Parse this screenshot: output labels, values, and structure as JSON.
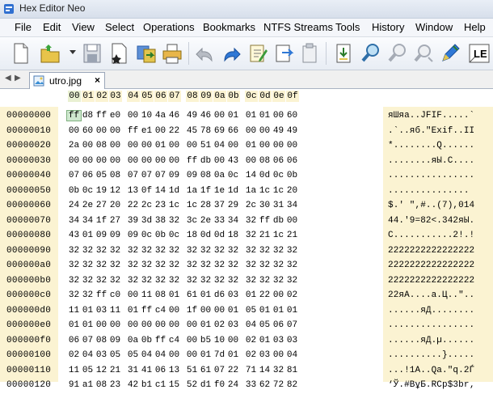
{
  "window": {
    "title": "Hex Editor Neo"
  },
  "menu": [
    "File",
    "Edit",
    "View",
    "Select",
    "Operations",
    "Bookmarks",
    "NTFS Streams",
    "Tools",
    "History",
    "Window",
    "Help"
  ],
  "toolbar": {
    "buttons": [
      "new-file-icon",
      "open-file-icon",
      "save-icon",
      "save-as-icon",
      "save-all-icon",
      "print-icon",
      "undo-icon",
      "redo-icon",
      "edit-icon",
      "paste-icon",
      "copy-icon",
      "import-icon",
      "find-icon",
      "find-next-icon",
      "replace-icon",
      "pen-icon",
      "endian-icon"
    ],
    "endian_label": "LE"
  },
  "tabs": {
    "nav_left": "◀",
    "nav_right": "▶",
    "active": {
      "label": "utro.jpg",
      "close": "×"
    }
  },
  "columns": [
    "00",
    "01",
    "02",
    "03",
    "04",
    "05",
    "06",
    "07",
    "08",
    "09",
    "0a",
    "0b",
    "0c",
    "0d",
    "0e",
    "0f"
  ],
  "rows": [
    {
      "offset": "00000000",
      "bytes": [
        "ff",
        "d8",
        "ff",
        "e0",
        "00",
        "10",
        "4a",
        "46",
        "49",
        "46",
        "00",
        "01",
        "01",
        "01",
        "00",
        "60"
      ],
      "ascii": "яШяа..JFIF.....`"
    },
    {
      "offset": "00000010",
      "bytes": [
        "00",
        "60",
        "00",
        "00",
        "ff",
        "e1",
        "00",
        "22",
        "45",
        "78",
        "69",
        "66",
        "00",
        "00",
        "49",
        "49"
      ],
      "ascii": ".`..яб.\"Exif..II"
    },
    {
      "offset": "00000020",
      "bytes": [
        "2a",
        "00",
        "08",
        "00",
        "00",
        "00",
        "01",
        "00",
        "00",
        "51",
        "04",
        "00",
        "01",
        "00",
        "00",
        "00"
      ],
      "ascii": "*........Q......"
    },
    {
      "offset": "00000030",
      "bytes": [
        "00",
        "00",
        "00",
        "00",
        "00",
        "00",
        "00",
        "00",
        "ff",
        "db",
        "00",
        "43",
        "00",
        "08",
        "06",
        "06"
      ],
      "ascii": "........яЫ.C...."
    },
    {
      "offset": "00000040",
      "bytes": [
        "07",
        "06",
        "05",
        "08",
        "07",
        "07",
        "07",
        "09",
        "09",
        "08",
        "0a",
        "0c",
        "14",
        "0d",
        "0c",
        "0b"
      ],
      "ascii": "................"
    },
    {
      "offset": "00000050",
      "bytes": [
        "0b",
        "0c",
        "19",
        "12",
        "13",
        "0f",
        "14",
        "1d",
        "1a",
        "1f",
        "1e",
        "1d",
        "1a",
        "1c",
        "1c",
        "20"
      ],
      "ascii": "............... "
    },
    {
      "offset": "00000060",
      "bytes": [
        "24",
        "2e",
        "27",
        "20",
        "22",
        "2c",
        "23",
        "1c",
        "1c",
        "28",
        "37",
        "29",
        "2c",
        "30",
        "31",
        "34"
      ],
      "ascii": "$.' \",#..(7),014"
    },
    {
      "offset": "00000070",
      "bytes": [
        "34",
        "34",
        "1f",
        "27",
        "39",
        "3d",
        "38",
        "32",
        "3c",
        "2e",
        "33",
        "34",
        "32",
        "ff",
        "db",
        "00"
      ],
      "ascii": "44.'9=82<.342яЫ."
    },
    {
      "offset": "00000080",
      "bytes": [
        "43",
        "01",
        "09",
        "09",
        "09",
        "0c",
        "0b",
        "0c",
        "18",
        "0d",
        "0d",
        "18",
        "32",
        "21",
        "1c",
        "21"
      ],
      "ascii": "C...........2!.!"
    },
    {
      "offset": "00000090",
      "bytes": [
        "32",
        "32",
        "32",
        "32",
        "32",
        "32",
        "32",
        "32",
        "32",
        "32",
        "32",
        "32",
        "32",
        "32",
        "32",
        "32"
      ],
      "ascii": "2222222222222222"
    },
    {
      "offset": "000000a0",
      "bytes": [
        "32",
        "32",
        "32",
        "32",
        "32",
        "32",
        "32",
        "32",
        "32",
        "32",
        "32",
        "32",
        "32",
        "32",
        "32",
        "32"
      ],
      "ascii": "2222222222222222"
    },
    {
      "offset": "000000b0",
      "bytes": [
        "32",
        "32",
        "32",
        "32",
        "32",
        "32",
        "32",
        "32",
        "32",
        "32",
        "32",
        "32",
        "32",
        "32",
        "32",
        "32"
      ],
      "ascii": "2222222222222222"
    },
    {
      "offset": "000000c0",
      "bytes": [
        "32",
        "32",
        "ff",
        "c0",
        "00",
        "11",
        "08",
        "01",
        "61",
        "01",
        "d6",
        "03",
        "01",
        "22",
        "00",
        "02"
      ],
      "ascii": "22яА....a.Ц..\".."
    },
    {
      "offset": "000000d0",
      "bytes": [
        "11",
        "01",
        "03",
        "11",
        "01",
        "ff",
        "c4",
        "00",
        "1f",
        "00",
        "00",
        "01",
        "05",
        "01",
        "01",
        "01"
      ],
      "ascii": "......яД........"
    },
    {
      "offset": "000000e0",
      "bytes": [
        "01",
        "01",
        "00",
        "00",
        "00",
        "00",
        "00",
        "00",
        "00",
        "01",
        "02",
        "03",
        "04",
        "05",
        "06",
        "07"
      ],
      "ascii": "................"
    },
    {
      "offset": "000000f0",
      "bytes": [
        "06",
        "07",
        "08",
        "09",
        "0a",
        "0b",
        "ff",
        "c4",
        "00",
        "b5",
        "10",
        "00",
        "02",
        "01",
        "03",
        "03"
      ],
      "ascii": "......яД.µ......"
    },
    {
      "offset": "00000100",
      "bytes": [
        "02",
        "04",
        "03",
        "05",
        "05",
        "04",
        "04",
        "00",
        "00",
        "01",
        "7d",
        "01",
        "02",
        "03",
        "00",
        "04"
      ],
      "ascii": "..........}....."
    },
    {
      "offset": "00000110",
      "bytes": [
        "11",
        "05",
        "12",
        "21",
        "31",
        "41",
        "06",
        "13",
        "51",
        "61",
        "07",
        "22",
        "71",
        "14",
        "32",
        "81"
      ],
      "ascii": "...!1A..Qa.\"q.2Ѓ"
    },
    {
      "offset": "00000120",
      "bytes": [
        "91",
        "a1",
        "08",
        "23",
        "42",
        "b1",
        "c1",
        "15",
        "52",
        "d1",
        "f0",
        "24",
        "33",
        "62",
        "72",
        "82"
      ],
      "ascii": "‘Ў.#BұБ.RСр$3br‚"
    }
  ],
  "selection": {
    "row": 0,
    "col": 0
  }
}
